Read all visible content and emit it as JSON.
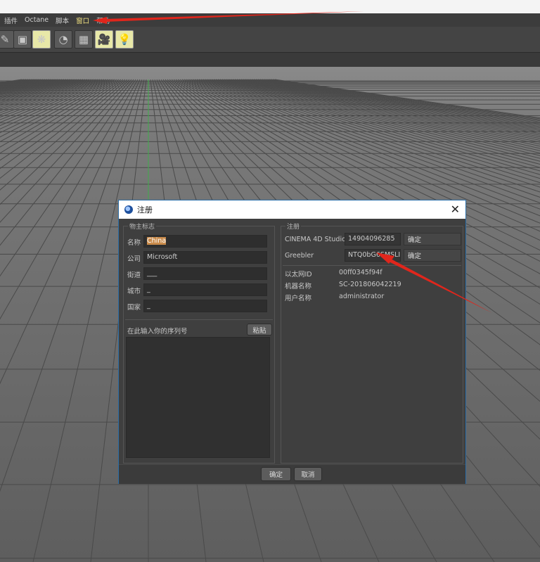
{
  "menubar": {
    "items": [
      {
        "label": "插件"
      },
      {
        "label": "Octane"
      },
      {
        "label": "脚本"
      },
      {
        "label": "窗口",
        "active": true
      },
      {
        "label": "帮助"
      }
    ]
  },
  "toolbar": {
    "icons": [
      {
        "name": "pen-icon",
        "glyph": "✎"
      },
      {
        "name": "cube-icon",
        "glyph": "▣"
      },
      {
        "name": "cloner-icon",
        "glyph": "❋"
      },
      {
        "name": "deformer-icon",
        "glyph": "◔"
      },
      {
        "name": "floor-icon",
        "glyph": "▦"
      },
      {
        "name": "camera-icon",
        "glyph": "🎥"
      },
      {
        "name": "light-icon",
        "glyph": "💡"
      }
    ]
  },
  "dialog": {
    "title": "注册",
    "left": {
      "group_title": "物主标志",
      "fields": [
        {
          "label": "名称",
          "value": "China"
        },
        {
          "label": "公司",
          "value": "Microsoft"
        },
        {
          "label": "街道",
          "value": "___"
        },
        {
          "label": "城市",
          "value": "_"
        },
        {
          "label": "国家",
          "value": "_"
        }
      ],
      "serial_label": "在此输入你的序列号",
      "paste_label": "粘贴",
      "serial_value": ""
    },
    "right": {
      "group_title": "注册",
      "products": [
        {
          "label": "CINEMA 4D Studio",
          "serial": "14904096285",
          "confirm": "确定"
        },
        {
          "label": "Greebler",
          "serial": "NTQ0bG6SMSLI",
          "confirm": "确定"
        }
      ],
      "info": [
        {
          "label": "以太网ID",
          "value": "00ff0345f94f"
        },
        {
          "label": "机器名称",
          "value": "SC-201806042219"
        },
        {
          "label": "用户名称",
          "value": "administrator"
        }
      ]
    },
    "ok_label": "确定",
    "cancel_label": "取消"
  },
  "colors": {
    "arrow": "#e0261c",
    "accent_border": "#2b6ea8"
  }
}
